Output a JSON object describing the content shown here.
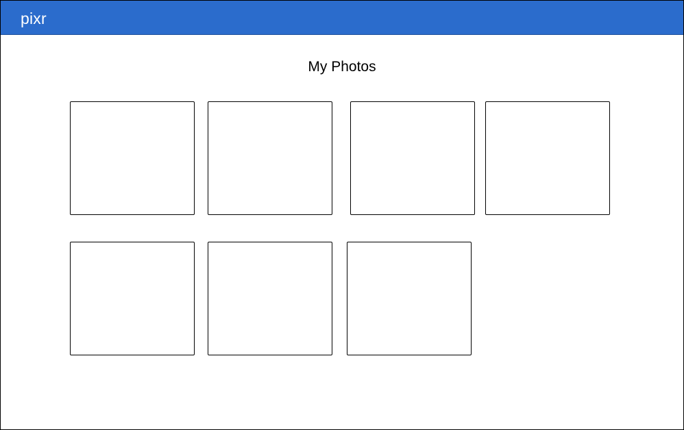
{
  "app": {
    "name": "pixr",
    "brand_color": "#2b6ccc"
  },
  "page": {
    "title": "My Photos"
  },
  "gallery": {
    "photo_count": 7
  }
}
